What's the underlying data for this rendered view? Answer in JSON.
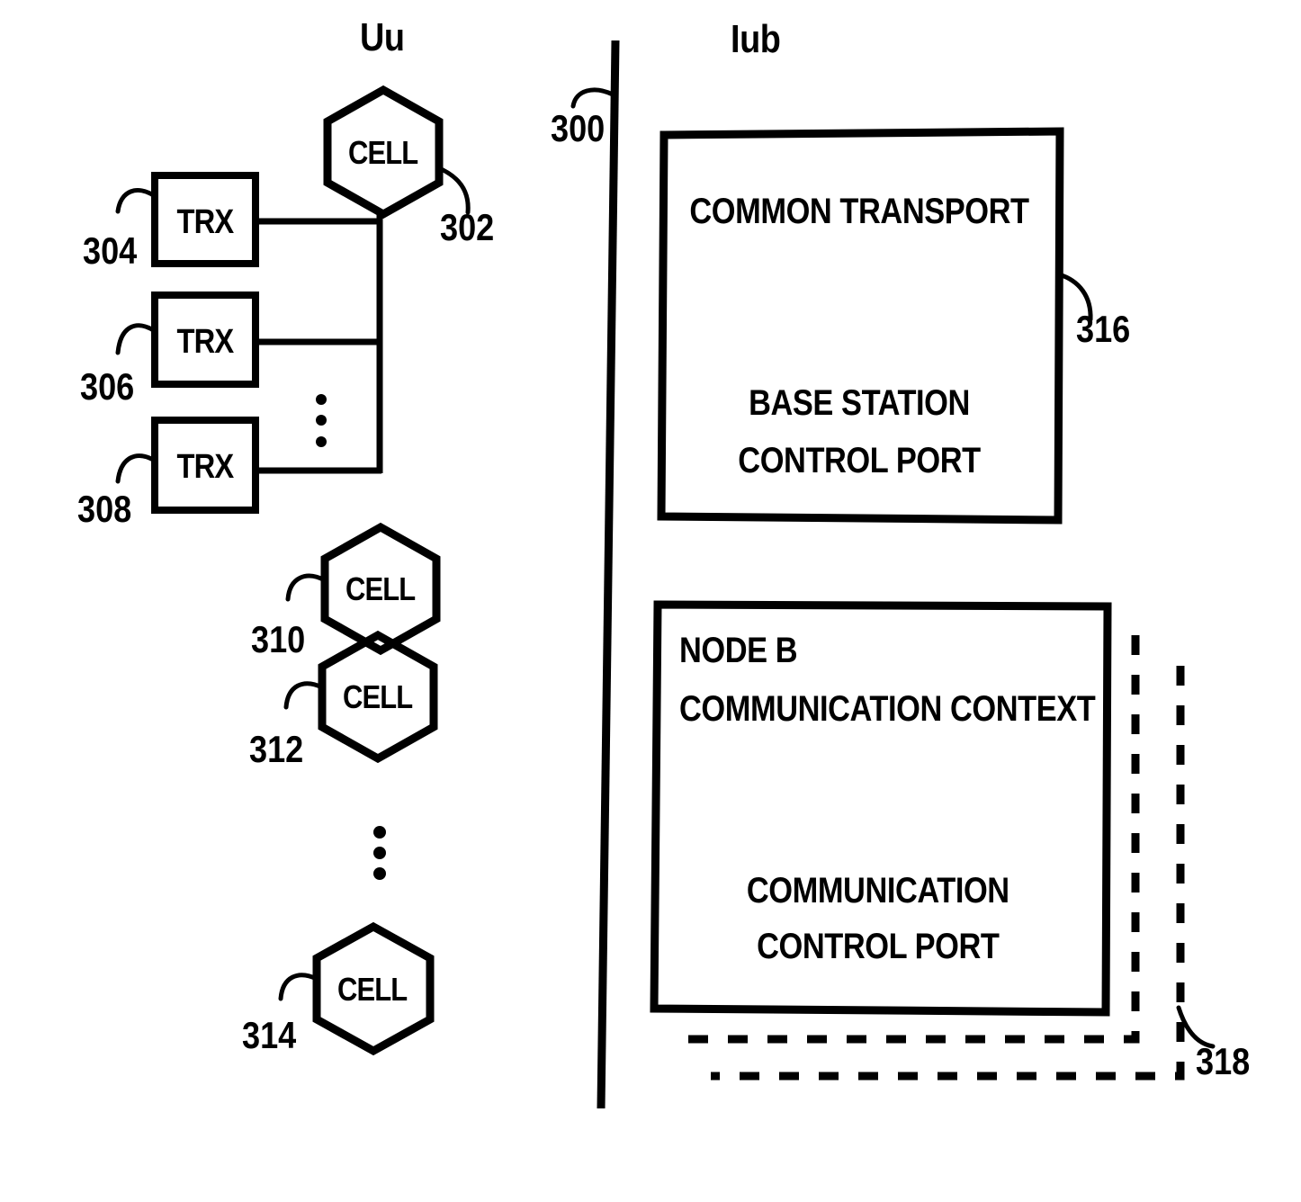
{
  "figure": {
    "type": "patent-diagram",
    "interfaces": {
      "left_label": "Uu",
      "right_label": "Iub"
    },
    "reference_numerals": {
      "boundary": "300",
      "cell_top": "302",
      "trx_1": "304",
      "trx_2": "306",
      "trx_3": "308",
      "cell_a": "310",
      "cell_b": "312",
      "cell_n": "314",
      "common_transport_box": "316",
      "node_b_context_box": "318"
    },
    "left_side": {
      "transceivers": [
        {
          "label": "TRX",
          "ref": "304"
        },
        {
          "label": "TRX",
          "ref": "306"
        },
        {
          "label": "TRX",
          "ref": "308"
        }
      ],
      "trx_ellipsis": "⋮",
      "cells": [
        {
          "label": "CELL",
          "ref": "302"
        },
        {
          "label": "CELL",
          "ref": "310"
        },
        {
          "label": "CELL",
          "ref": "312"
        },
        {
          "label": "CELL",
          "ref": "314"
        }
      ],
      "cell_ellipsis": "⋮"
    },
    "right_side": {
      "boxes": [
        {
          "ref": "316",
          "title": "COMMON TRANSPORT",
          "body_line1": "BASE STATION",
          "body_line2": "CONTROL PORT",
          "style": "solid"
        },
        {
          "ref": "318",
          "title_line1": "NODE B",
          "title_line2": "COMMUNICATION CONTEXT",
          "body_line1": "COMMUNICATION",
          "body_line2": "CONTROL PORT",
          "style": "solid-with-dashed-stack"
        }
      ]
    },
    "colors": {
      "ink": "#000000",
      "paper": "#ffffff"
    }
  }
}
